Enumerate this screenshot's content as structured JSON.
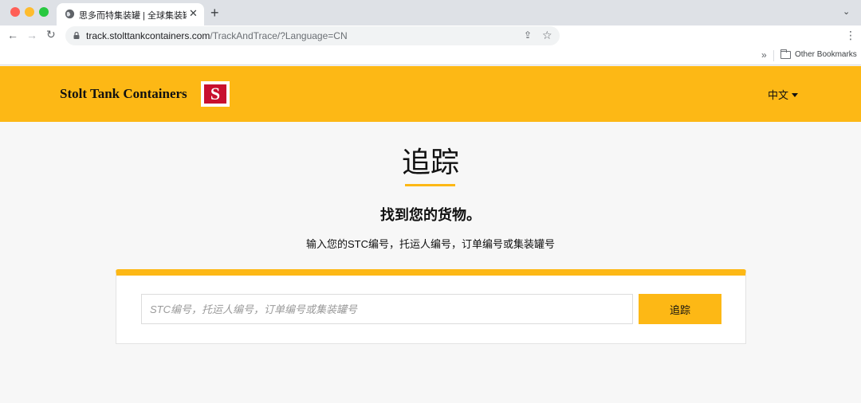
{
  "browser": {
    "tab_title": "思多而特集装罐 | 全球集装罐运输",
    "url_host": "track.stolttankcontainers.com",
    "url_path": "/TrackAndTrace/?Language=CN",
    "other_bookmarks": "Other Bookmarks"
  },
  "header": {
    "brand": "Stolt Tank Containers",
    "logo_letter": "S",
    "language": "中文"
  },
  "main": {
    "title": "追踪",
    "subtitle": "找到您的货物。",
    "instructions": "输入您的STC编号，托运人编号，订单编号或集装罐号",
    "search": {
      "placeholder": "STC编号，托运人编号，订单编号或集装罐号",
      "value": "",
      "button_label": "追踪"
    }
  },
  "colors": {
    "accent": "#fdb815",
    "logo_red": "#c8102e"
  }
}
